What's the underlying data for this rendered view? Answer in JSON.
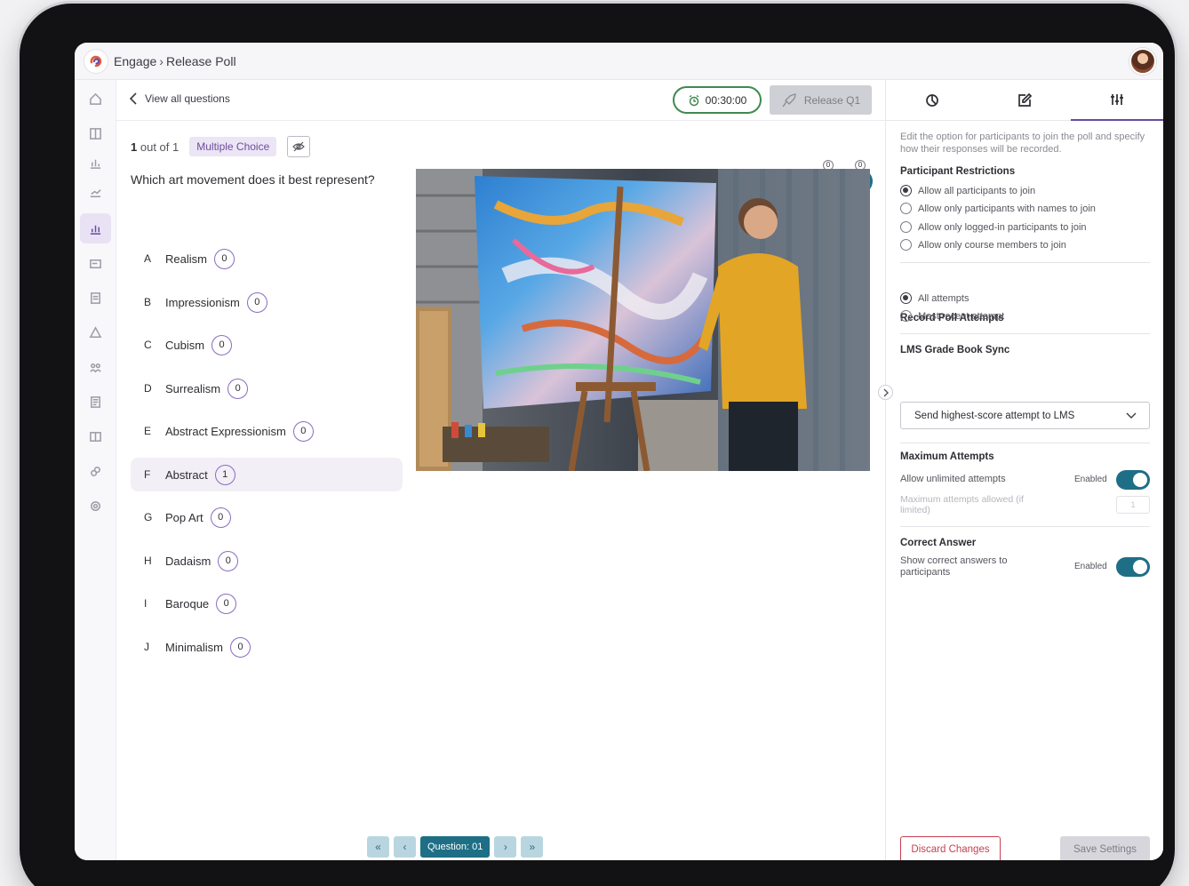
{
  "header": {
    "breadcrumb": [
      "Engage",
      "Release Poll"
    ]
  },
  "sidebar": {
    "icons": [
      "home-icon",
      "book-icon",
      "chart-icon",
      "users-chart-icon",
      "poll-icon",
      "card-icon",
      "document-icon",
      "triangle-icon",
      "group-icon",
      "list-icon",
      "gallery-icon",
      "link-icon",
      "settings-icon"
    ],
    "active": "poll-icon"
  },
  "subheader": {
    "back_label": "View all questions",
    "timer": "00:30:00",
    "release_label": "Release Q1"
  },
  "question": {
    "index": "1",
    "out_of": "out of 1",
    "type_badge": "Multiple Choice",
    "text": "Which art movement does it best represent?",
    "options": [
      {
        "letter": "A",
        "label": "Realism",
        "count": "0"
      },
      {
        "letter": "B",
        "label": "Impressionism",
        "count": "0"
      },
      {
        "letter": "C",
        "label": "Cubism",
        "count": "0"
      },
      {
        "letter": "D",
        "label": "Surrealism",
        "count": "0"
      },
      {
        "letter": "E",
        "label": "Abstract Expressionism",
        "count": "0"
      },
      {
        "letter": "F",
        "label": "Abstract",
        "count": "1"
      },
      {
        "letter": "G",
        "label": "Pop Art",
        "count": "0"
      },
      {
        "letter": "H",
        "label": "Dadaism",
        "count": "0"
      },
      {
        "letter": "I",
        "label": "Baroque",
        "count": "0"
      },
      {
        "letter": "J",
        "label": "Minimalism",
        "count": "0"
      }
    ],
    "selected_option": "F"
  },
  "reactions": {
    "thumbs_up": "0",
    "thumbs_down": "0"
  },
  "pager": {
    "first": "«",
    "prev": "‹",
    "label": "Question: 01",
    "next": "›",
    "last": "»"
  },
  "panel": {
    "tabs": [
      "chart-tab",
      "edit-tab",
      "settings-tab"
    ],
    "active_tab": "settings-tab",
    "intro": "Edit the option for participants to join the poll and specify how their responses will be recorded.",
    "participant_restrictions": {
      "title": "Participant Restrictions",
      "options": [
        "Allow all participants to join",
        "Allow only participants with names to join",
        "Allow only logged-in participants to join",
        "Allow only course members to join"
      ],
      "selected": "Allow all participants to join"
    },
    "record_attempts": {
      "title": "Record Poll Attempts",
      "options": [
        "All attempts",
        "Most recent attempt"
      ],
      "selected": "All attempts"
    },
    "lms_sync": {
      "title": "LMS Grade Book Sync",
      "value": "Send highest-score attempt to LMS"
    },
    "max_attempts": {
      "title": "Maximum Attempts",
      "label": "Allow unlimited attempts",
      "status": "Enabled",
      "sub_label": "Maximum attempts allowed (if limited)",
      "sub_value": "1"
    },
    "correct_answer": {
      "title": "Correct Answer",
      "label": "Show correct answers to participants",
      "status": "Enabled"
    },
    "discard_label": "Discard Changes",
    "save_label": "Save Settings"
  },
  "colors": {
    "accent_purple": "#6a4aa2",
    "accent_teal": "#1e6f86",
    "timer_green": "#3f8a4e",
    "danger": "#c64152"
  }
}
